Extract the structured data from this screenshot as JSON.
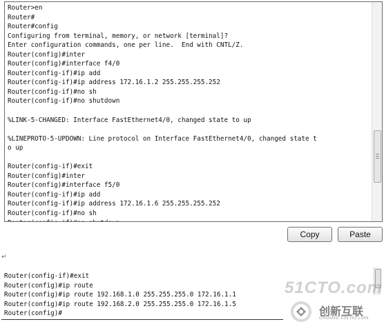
{
  "console": {
    "lines": [
      "Router>en",
      "Router#",
      "Router#config",
      "Configuring from terminal, memory, or network [terminal]?",
      "Enter configuration commands, one per line.  End with CNTL/Z.",
      "Router(config)#inter",
      "Router(config)#interface f4/0",
      "Router(config-if)#ip add",
      "Router(config-if)#ip address 172.16.1.2 255.255.255.252",
      "Router(config-if)#no sh",
      "Router(config-if)#no shutdown",
      "",
      "%LINK-5-CHANGED: Interface FastEthernet4/0, changed state to up",
      "",
      "%LINEPROTO-5-UPDOWN: Line protocol on Interface FastEthernet4/0, changed state t",
      "o up",
      "",
      "Router(config-if)#exit",
      "Router(config)#inter",
      "Router(config)#interface f5/0",
      "Router(config-if)#ip add",
      "Router(config-if)#ip address 172.16.1.6 255.255.255.252",
      "Router(config-if)#no sh",
      "Router(config-if)#no shutdown"
    ]
  },
  "buttons": {
    "copy": "Copy",
    "paste": "Paste"
  },
  "paragraph_mark": "↵",
  "console2": {
    "lines": [
      "Router(config-if)#exit",
      "Router(config)#ip route",
      "Router(config)#ip route 192.168.1.0 255.255.255.0 172.16.1.1",
      "Router(config)#ip route 192.168.2.0 255.255.255.0 172.16.1.5",
      "Router(config)#"
    ]
  },
  "watermark": {
    "site_text": "51CTO.com",
    "brand_cn": "创新互联",
    "brand_en": "CHUANG XIN HU LIAN"
  }
}
